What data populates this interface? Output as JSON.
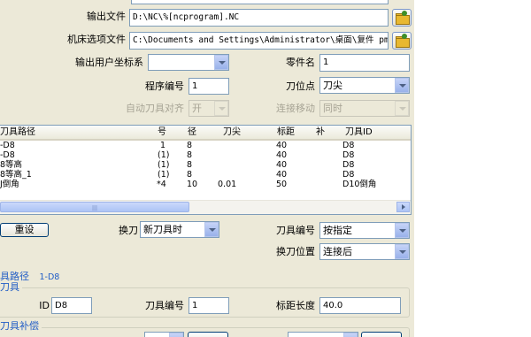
{
  "output": {
    "file_label": "输出文件",
    "file_value": "D:\\NC\\%[ncprogram].NC",
    "option_label": "机床选项文件",
    "option_value": "C:\\Documents and Settings\\Administrator\\桌面\\复件 pm法."
  },
  "params": {
    "coord_label": "输出用户坐标系",
    "coord_value": "",
    "part_label": "零件名",
    "part_value": "1",
    "prog_label": "程序编号",
    "prog_value": "1",
    "toolpos_label": "刀位点",
    "toolpos_value": "刀尖",
    "autoalign_label": "自动刀具对齐",
    "autoalign_value": "开",
    "connect_label": "连接移动",
    "connect_value": "同时"
  },
  "list": {
    "headers": [
      "刀具路径",
      "号",
      "径",
      "刀尖",
      "标距",
      "补",
      "刀具ID"
    ],
    "rows": [
      [
        "-D8",
        "1",
        "8",
        "",
        "40",
        "",
        "D8"
      ],
      [
        "-D8",
        "(1)",
        "8",
        "",
        "40",
        "",
        "D8"
      ],
      [
        "8等高",
        "(1)",
        "8",
        "",
        "40",
        "",
        "D8"
      ],
      [
        "8等高_1",
        "(1)",
        "8",
        "",
        "40",
        "",
        "D8"
      ],
      [
        "J倒角",
        "*4",
        "10",
        "0.01",
        "50",
        "",
        "D10倒角"
      ]
    ],
    "scroll_grip": "|||"
  },
  "controls": {
    "reset_label": "重设",
    "change_label": "换刀",
    "change_value": "新刀具时",
    "toolno_label": "刀具编号",
    "toolno_value": "按指定",
    "changepos_label": "换刀位置",
    "changepos_value": "连接后"
  },
  "path_section": {
    "title": "具路径",
    "name": "1-D8"
  },
  "tool_section": {
    "title": "刀具",
    "id_label": "ID",
    "id_value": "D8",
    "number_label": "刀具编号",
    "number_value": "1",
    "length_label": "标距长度",
    "length_value": "40.0"
  },
  "comp_section": {
    "title": "刀具补偿"
  },
  "icons": [
    "folder-open-icon",
    "chevron-down-icon",
    "chevron-right-icon"
  ]
}
